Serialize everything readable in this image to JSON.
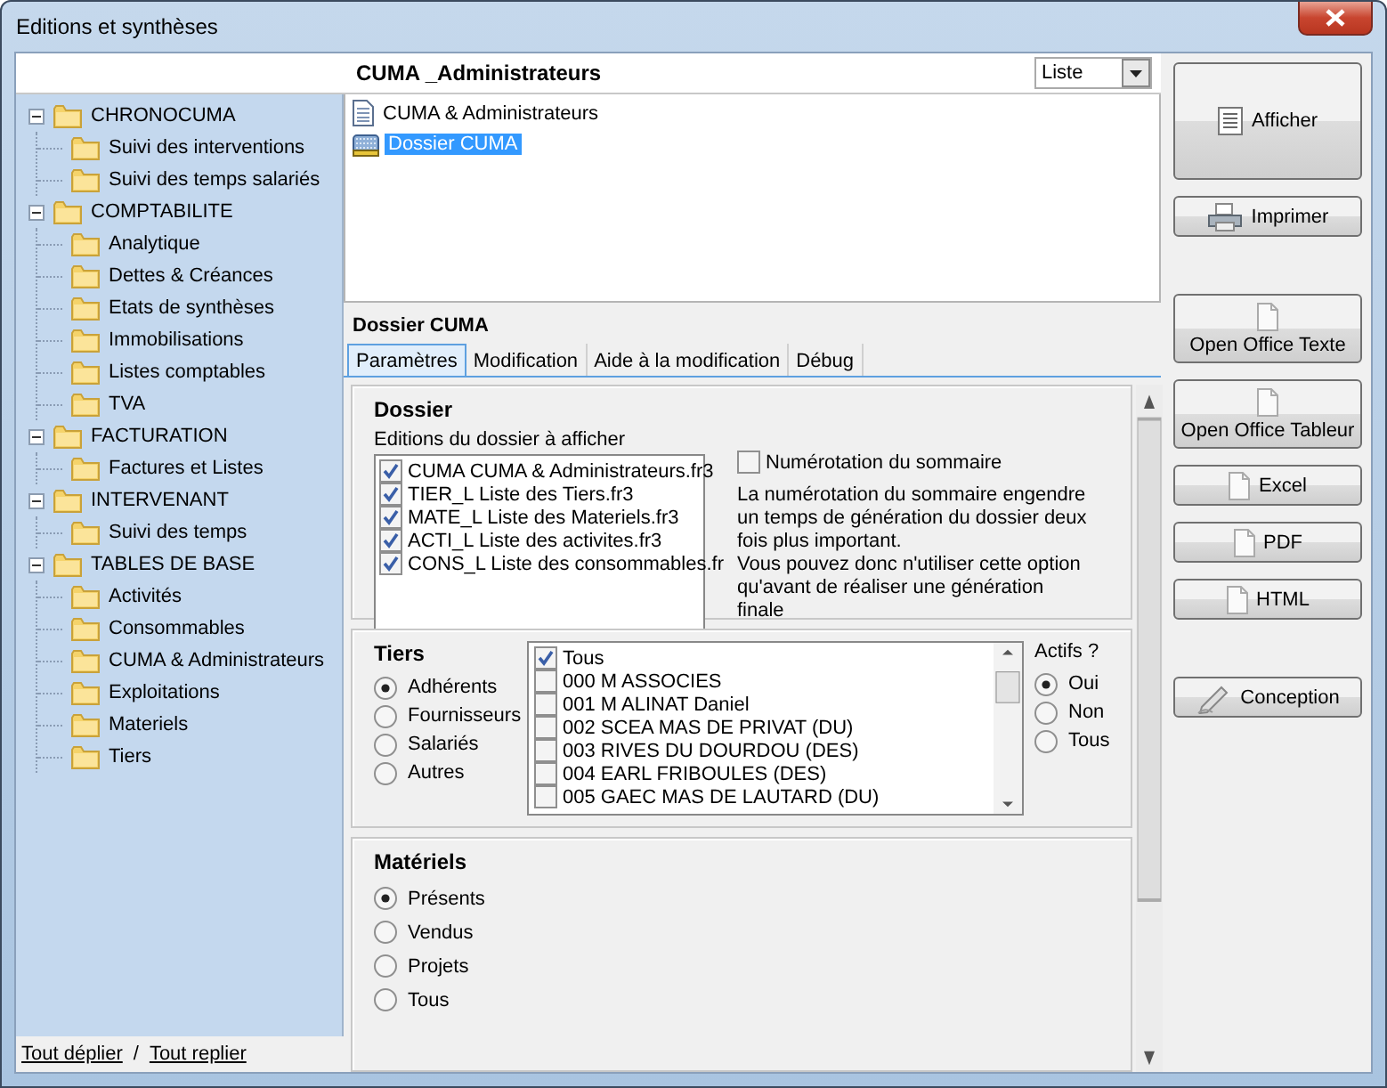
{
  "window": {
    "title": "Editions et synthèses"
  },
  "header": {
    "title": "CUMA _Administrateurs",
    "view_select": {
      "value": "Liste"
    }
  },
  "tree": {
    "items": [
      {
        "label": "CHRONOCUMA",
        "expanded": true,
        "children": [
          {
            "label": "Suivi des interventions"
          },
          {
            "label": "Suivi des temps salariés"
          }
        ]
      },
      {
        "label": "COMPTABILITE",
        "expanded": true,
        "children": [
          {
            "label": "Analytique"
          },
          {
            "label": "Dettes & Créances"
          },
          {
            "label": "Etats de synthèses"
          },
          {
            "label": "Immobilisations"
          },
          {
            "label": "Listes comptables"
          },
          {
            "label": "TVA"
          }
        ]
      },
      {
        "label": "FACTURATION",
        "expanded": true,
        "children": [
          {
            "label": "Factures et Listes"
          }
        ]
      },
      {
        "label": "INTERVENANT",
        "expanded": true,
        "children": [
          {
            "label": "Suivi des temps"
          }
        ]
      },
      {
        "label": "TABLES DE BASE",
        "expanded": true,
        "children": [
          {
            "label": "Activités"
          },
          {
            "label": "Consommables"
          },
          {
            "label": "CUMA & Administrateurs"
          },
          {
            "label": "Exploitations"
          },
          {
            "label": "Materiels"
          },
          {
            "label": "Tiers"
          }
        ]
      }
    ],
    "links": {
      "expand_all": "Tout déplier",
      "separator": "/",
      "collapse_all": "Tout replier"
    }
  },
  "file_list": {
    "items": [
      {
        "label": "CUMA & Administrateurs",
        "kind": "document",
        "selected": false
      },
      {
        "label": "Dossier CUMA",
        "kind": "dossier",
        "selected": true
      }
    ]
  },
  "detail": {
    "title": "Dossier CUMA",
    "tabs": [
      {
        "label": "Paramètres",
        "selected": true
      },
      {
        "label": "Modification",
        "selected": false
      },
      {
        "label": "Aide à la modification",
        "selected": false
      },
      {
        "label": "Débug",
        "selected": false
      }
    ],
    "dossier": {
      "title": "Dossier",
      "list_label": "Editions du dossier à afficher",
      "files": [
        {
          "label": "CUMA CUMA & Administrateurs.fr3",
          "checked": true
        },
        {
          "label": "TIER_L Liste des Tiers.fr3",
          "checked": true
        },
        {
          "label": "MATE_L Liste des Materiels.fr3",
          "checked": true
        },
        {
          "label": "ACTI_L Liste des activites.fr3",
          "checked": true
        },
        {
          "label": "CONS_L Liste des consommables.fr",
          "checked": true
        }
      ],
      "numbering": {
        "label": "Numérotation du sommaire",
        "checked": false
      },
      "note": "La numérotation du sommaire engendre un temps de génération du dossier deux fois plus important.\nVous pouvez donc n'utiliser cette option qu'avant de réaliser une génération finale"
    },
    "tiers": {
      "title": "Tiers",
      "options": [
        {
          "label": "Adhérents",
          "selected": true
        },
        {
          "label": "Fournisseurs",
          "selected": false
        },
        {
          "label": "Salariés",
          "selected": false
        },
        {
          "label": "Autres",
          "selected": false
        }
      ],
      "items": [
        {
          "label": "Tous",
          "checked": true
        },
        {
          "label": "000 M ASSOCIES",
          "checked": false
        },
        {
          "label": "001 M ALINAT Daniel",
          "checked": false
        },
        {
          "label": "002 SCEA MAS DE PRIVAT (DU)",
          "checked": false
        },
        {
          "label": "003 RIVES DU DOURDOU (DES)",
          "checked": false
        },
        {
          "label": "004 EARL FRIBOULES (DES)",
          "checked": false
        },
        {
          "label": "005 GAEC MAS DE LAUTARD (DU)",
          "checked": false
        }
      ],
      "actifs": {
        "title": "Actifs ?",
        "options": [
          {
            "label": "Oui",
            "selected": true
          },
          {
            "label": "Non",
            "selected": false
          },
          {
            "label": "Tous",
            "selected": false
          }
        ]
      }
    },
    "materiels": {
      "title": "Matériels",
      "options": [
        {
          "label": "Présents",
          "selected": true
        },
        {
          "label": "Vendus",
          "selected": false
        },
        {
          "label": "Projets",
          "selected": false
        },
        {
          "label": "Tous",
          "selected": false
        }
      ]
    }
  },
  "button_groups": [
    [
      {
        "label": "Afficher",
        "kind": "display"
      },
      {
        "label": "Imprimer",
        "kind": "print"
      }
    ],
    [
      {
        "label": "Open Office Texte",
        "kind": "office"
      },
      {
        "label": "Open Office Tableur",
        "kind": "office"
      },
      {
        "label": "Excel",
        "kind": "export"
      },
      {
        "label": "PDF",
        "kind": "export"
      },
      {
        "label": "HTML",
        "kind": "export"
      }
    ],
    [
      {
        "label": "Conception",
        "kind": "design"
      }
    ]
  ]
}
